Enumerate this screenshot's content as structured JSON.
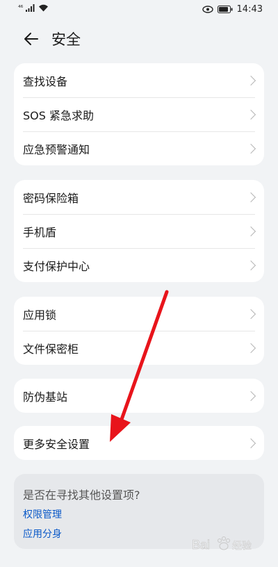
{
  "status_bar": {
    "signal_text": "⁴⁶",
    "time": "14:43",
    "icons": [
      "signal-icon",
      "wifi-icon",
      "eye-icon",
      "battery-icon"
    ]
  },
  "header": {
    "back_icon": "arrow-left-icon",
    "title": "安全"
  },
  "groups": [
    {
      "items": [
        "查找设备",
        "SOS 紧急求助",
        "应急预警通知"
      ]
    },
    {
      "items": [
        "密码保险箱",
        "手机盾",
        "支付保护中心"
      ]
    },
    {
      "items": [
        "应用锁",
        "文件保密柜"
      ]
    },
    {
      "items": [
        "防伪基站"
      ]
    },
    {
      "items": [
        "更多安全设置"
      ]
    }
  ],
  "suggestion": {
    "title": "是否在寻找其他设置项?",
    "links": [
      "权限管理",
      "应用分身"
    ]
  },
  "colors": {
    "background": "#f1f3f5",
    "card": "#ffffff",
    "link": "#0a59c8",
    "annotation_arrow": "#e8141b"
  },
  "watermark": {
    "text": "Bai 经验",
    "icon": "paw-logo-icon"
  }
}
